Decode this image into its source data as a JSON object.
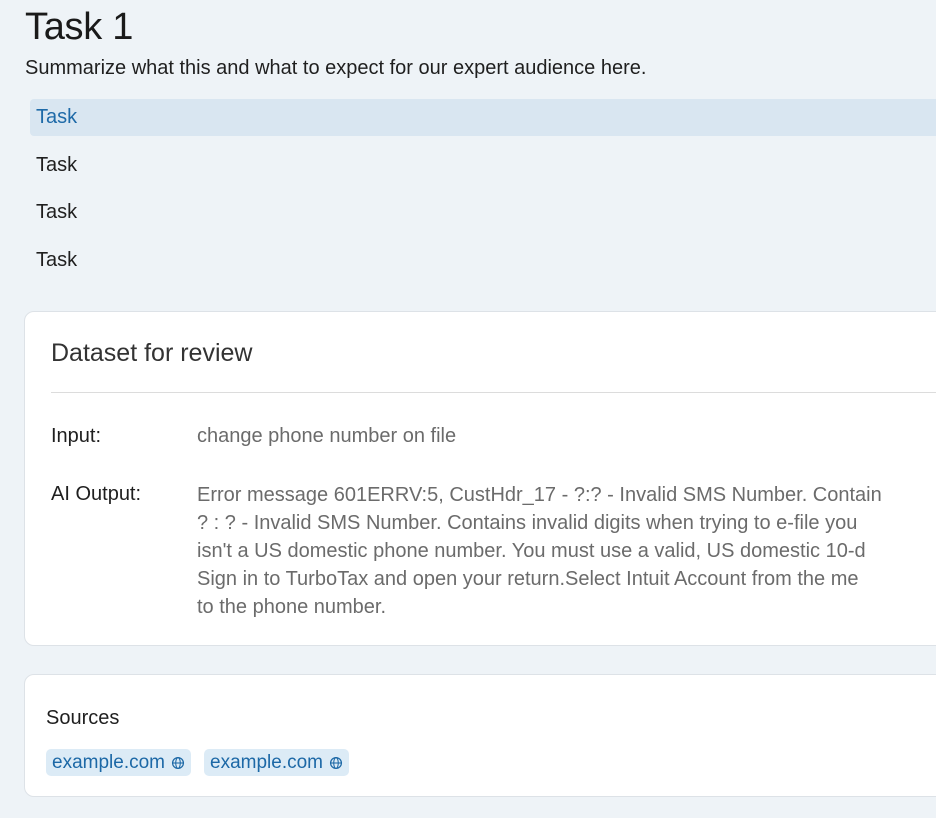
{
  "header": {
    "title": "Task 1",
    "subtitle": "Summarize what this and what to expect for our expert audience here."
  },
  "tasks": [
    {
      "label": "Task",
      "active": true
    },
    {
      "label": "Task",
      "active": false
    },
    {
      "label": "Task",
      "active": false
    },
    {
      "label": "Task",
      "active": false
    }
  ],
  "dataset": {
    "title": "Dataset for review",
    "input_label": "Input:",
    "input_value": "change phone number on file",
    "output_label": "AI Output:",
    "output_lines": [
      "Error message 601ERRV:5, CustHdr_17 - ?:? - Invalid SMS Number. Contain",
      "? : ? - Invalid SMS Number. Contains invalid digits when trying to e-file you",
      "isn't a US domestic phone number. You must use a valid, US domestic 10-d",
      "Sign in to TurboTax and open your return.Select Intuit Account from the me",
      "to the phone number."
    ]
  },
  "sources": {
    "title": "Sources",
    "links": [
      {
        "label": "example.com",
        "icon": "globe-icon"
      },
      {
        "label": "example.com",
        "icon": "globe-icon"
      }
    ]
  },
  "colors": {
    "background": "#eef3f7",
    "accent": "#1e6aa8",
    "active_task_bg": "#d9e6f1",
    "chip_bg": "#dcebf6"
  }
}
